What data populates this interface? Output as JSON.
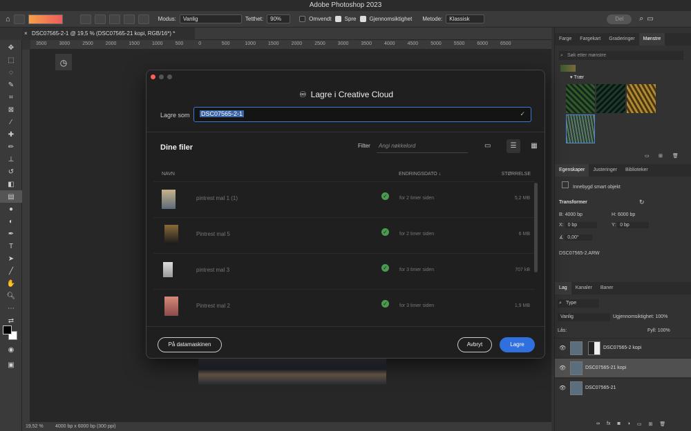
{
  "app": {
    "title": "Adobe Photoshop 2023"
  },
  "options": {
    "mode_label": "Modus:",
    "mode_value": "Vanlig",
    "density_label": "Tetthet:",
    "density_value": "90%",
    "reverse_label": "Omvendt",
    "spread_label": "Spre",
    "transparency_label": "Gjennomsiktighet",
    "method_label": "Metode:",
    "method_value": "Klassisk",
    "share_label": "Del"
  },
  "document": {
    "tab_title": "DSC07565-2-1 @ 19,5 % (DSC07565-21 kopi, RGB/16*) *"
  },
  "ruler": {
    "ticks": [
      "3500",
      "3000",
      "2500",
      "2000",
      "1500",
      "1000",
      "500",
      "0",
      "500",
      "1000",
      "1500",
      "2000",
      "2500",
      "3000",
      "3500",
      "4000",
      "4500",
      "5000",
      "5500",
      "6000",
      "6500"
    ]
  },
  "status": {
    "zoom": "19,52 %",
    "info": "4000 bp x 6000 bp (300 ppi)"
  },
  "dialog": {
    "title": "Lagre i Creative Cloud",
    "save_as_label": "Lagre som",
    "save_as_value": "DSC07565-2-1",
    "files_title": "Dine filer",
    "filter_label": "Filter",
    "filter_placeholder": "Angi nøkkelord",
    "col_name": "NAVN",
    "col_date": "ENDRINGSDATO",
    "col_size": "STØRRELSE",
    "files": [
      {
        "name": "pintrest mal 1 (1)",
        "date": "for 2 timer siden",
        "size": "5,2 MB"
      },
      {
        "name": "Pintrest mal 5",
        "date": "for 2 timer siden",
        "size": "6 MB"
      },
      {
        "name": "pintrest mal 3",
        "date": "for 3 timer siden",
        "size": "707 kB"
      },
      {
        "name": "Pintrest mal 2",
        "date": "for 3 timer siden",
        "size": "1,9 MB"
      }
    ],
    "on_computer": "På datamaskinen",
    "cancel": "Avbryt",
    "save": "Lagre"
  },
  "panels": {
    "top_tabs": [
      "Farge",
      "Fargekart",
      "Graderinger",
      "Mønstre"
    ],
    "search_placeholder": "Søk etter mønstre",
    "group_label": "Trær",
    "props_tabs": [
      "Egenskaper",
      "Justeringer",
      "Biblioteker"
    ],
    "smart_object": "Innebygd smart objekt",
    "transform_title": "Transformer",
    "w_label": "B:",
    "w_value": "4000 bp",
    "h_label": "H:",
    "h_value": "6000 bp",
    "x_label": "X:",
    "x_value": "0 bp",
    "y_label": "Y:",
    "y_value": "0 bp",
    "angle_value": "0,00°",
    "source_file": "DSC07565-2.ARW",
    "layer_tabs": [
      "Lag",
      "Kanaler",
      "Baner"
    ],
    "kind_value": "Type",
    "blend_value": "Vanlig",
    "opacity_label": "Ugjennomsiktighet:",
    "opacity_value": "100%",
    "lock_label": "Lås:",
    "fill_label": "Fyll:",
    "fill_value": "100%",
    "layers": [
      "DSC07565-2 kopi",
      "DSC07565-21 kopi",
      "DSC07565-21"
    ]
  }
}
